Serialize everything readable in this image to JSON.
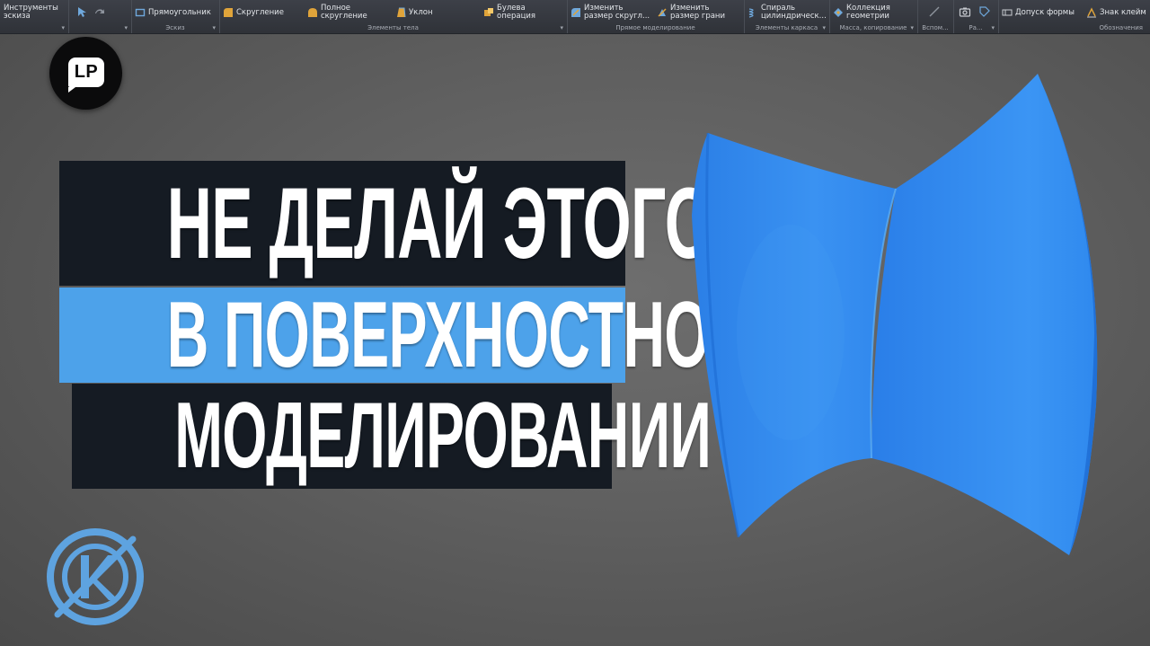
{
  "ribbon": {
    "groups": [
      {
        "caption": "",
        "buttons": [
          {
            "label1": "Инструменты",
            "label2": "эскиза",
            "icon": "sketch-tools-icon"
          }
        ]
      },
      {
        "caption": "",
        "buttons": []
      },
      {
        "caption": "Эскиз",
        "buttons": [
          {
            "label1": "Прямоугольник",
            "label2": "",
            "icon": "rectangle-icon"
          }
        ]
      },
      {
        "caption": "Элементы тела",
        "buttons": [
          {
            "label1": "Скругление",
            "label2": "",
            "icon": "fillet-icon"
          },
          {
            "label1": "Полное",
            "label2": "скругление",
            "icon": "full-fillet-icon"
          },
          {
            "label1": "Уклон",
            "label2": "",
            "icon": "draft-icon"
          },
          {
            "label1": "Булева",
            "label2": "операция",
            "icon": "boolean-icon"
          }
        ]
      },
      {
        "caption": "Прямое моделирование",
        "buttons": [
          {
            "label1": "Изменить",
            "label2": "размер скругл...",
            "icon": "resize-fillet-icon"
          },
          {
            "label1": "Изменить",
            "label2": "размер грани",
            "icon": "resize-face-icon"
          }
        ]
      },
      {
        "caption": "Элементы каркаса",
        "buttons": [
          {
            "label1": "Спираль",
            "label2": "цилиндрическ...",
            "icon": "helix-icon"
          }
        ]
      },
      {
        "caption": "Масса, копирование",
        "buttons": [
          {
            "label1": "Коллекция",
            "label2": "геометрии",
            "icon": "collection-icon"
          }
        ]
      },
      {
        "caption": "Вспом...",
        "buttons": []
      },
      {
        "caption": "Ра...",
        "buttons": []
      },
      {
        "caption": "Обозначения",
        "buttons": [
          {
            "label1": "Допуск формы",
            "label2": "",
            "icon": "form-tolerance-icon"
          },
          {
            "label1": "Знак клейм",
            "label2": "",
            "icon": "stamp-sign-icon"
          }
        ]
      }
    ]
  },
  "logo_lp": {
    "text": "LP"
  },
  "title": {
    "line1": "НЕ ДЕЛАЙ ЭТОГО",
    "line2": "В ПОВЕРХНОСТНОМ",
    "line3": "МОДЕЛИРОВАНИИ"
  },
  "logo_k": {
    "icon": "kompas-logo-icon"
  },
  "colors": {
    "accent_blue": "#4da2ea",
    "title_bg_dark": "#151b23",
    "shape_blue": "#2f8cf0",
    "background": "#606060"
  }
}
